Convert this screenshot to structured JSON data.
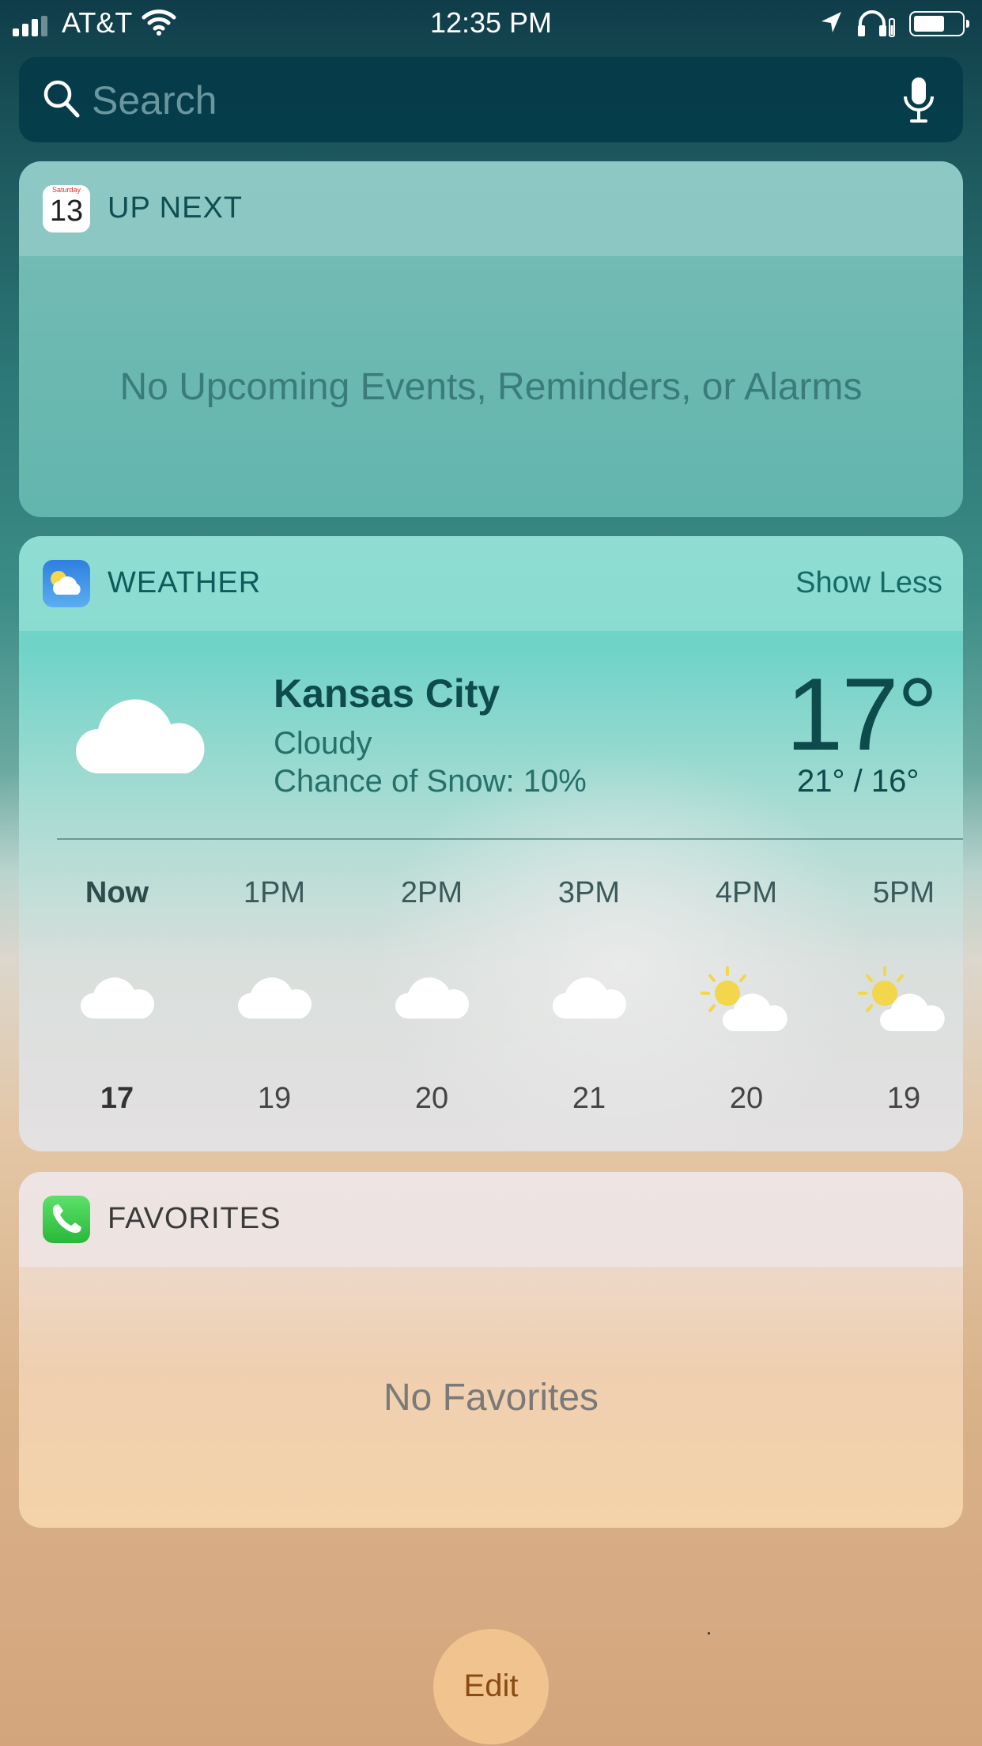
{
  "status_bar": {
    "carrier": "AT&T",
    "time": "12:35 PM",
    "battery_level": 0.6,
    "signal_bars": 3,
    "icons": [
      "signal-icon",
      "wifi-icon",
      "location-arrow-icon",
      "headphones-icon",
      "battery-icon"
    ]
  },
  "search": {
    "placeholder": "Search",
    "icons": [
      "search-icon",
      "microphone-icon"
    ]
  },
  "up_next": {
    "day": "Saturday",
    "date": "13",
    "title": "UP NEXT",
    "empty_message": "No Upcoming Events, Reminders, or Alarms"
  },
  "weather": {
    "title": "WEATHER",
    "show_less": "Show Less",
    "city": "Kansas City",
    "condition": "Cloudy",
    "precip": "Chance of Snow: 10%",
    "temperature": "17°",
    "hi_lo": "21° / 16°",
    "hourly": [
      {
        "label": "Now",
        "icon": "cloud-icon",
        "temp": "17"
      },
      {
        "label": "1PM",
        "icon": "cloud-icon",
        "temp": "19"
      },
      {
        "label": "2PM",
        "icon": "cloud-icon",
        "temp": "20"
      },
      {
        "label": "3PM",
        "icon": "cloud-icon",
        "temp": "21"
      },
      {
        "label": "4PM",
        "icon": "partly-sunny-icon",
        "temp": "20"
      },
      {
        "label": "5PM",
        "icon": "partly-sunny-icon",
        "temp": "19"
      }
    ]
  },
  "favorites": {
    "title": "FAVORITES",
    "empty_message": "No Favorites"
  },
  "edit_button": "Edit",
  "colors": {
    "teal_text": "#0d4b4c",
    "edit_bg": "#f1c48f",
    "edit_text": "#8a4b12"
  }
}
